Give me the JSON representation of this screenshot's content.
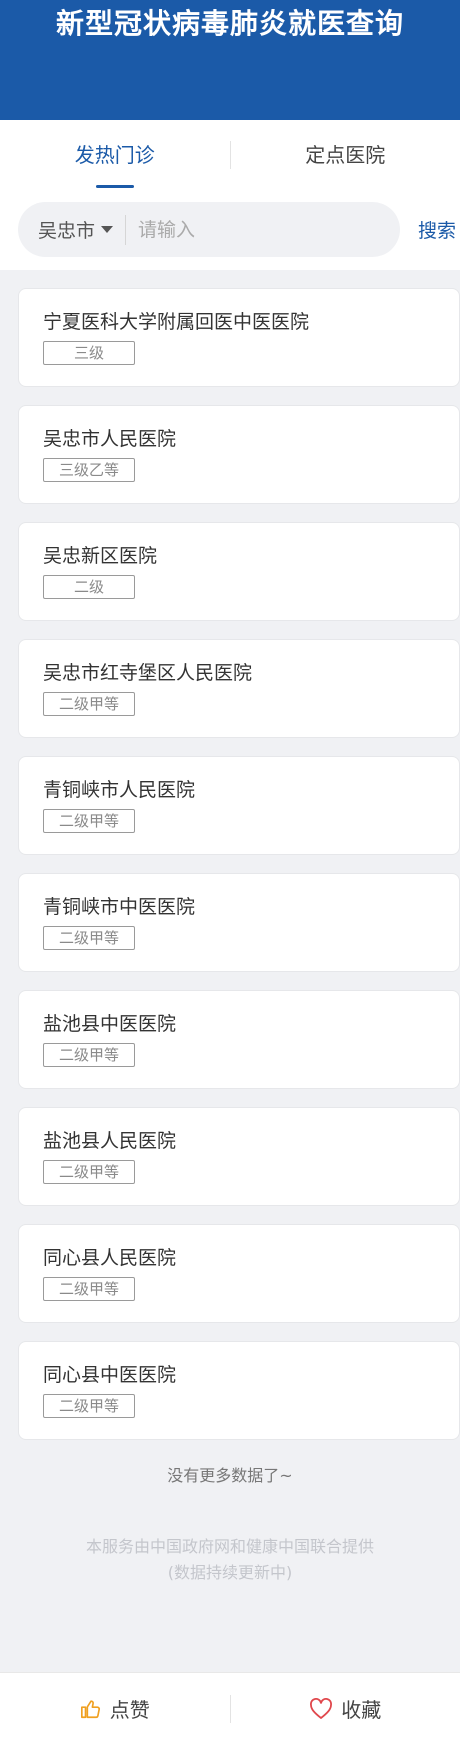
{
  "header": {
    "title": "新型冠状病毒肺炎就医查询"
  },
  "tabs": [
    {
      "label": "发热门诊",
      "active": true
    },
    {
      "label": "定点医院",
      "active": false
    }
  ],
  "search": {
    "city": "吴忠市",
    "placeholder": "请输入",
    "value": "",
    "button_label": "搜索"
  },
  "hospitals": [
    {
      "name": "宁夏医科大学附属回医中医医院",
      "level": "三级"
    },
    {
      "name": "吴忠市人民医院",
      "level": "三级乙等"
    },
    {
      "name": "吴忠新区医院",
      "level": "二级"
    },
    {
      "name": "吴忠市红寺堡区人民医院",
      "level": "二级甲等"
    },
    {
      "name": "青铜峡市人民医院",
      "level": "二级甲等"
    },
    {
      "name": "青铜峡市中医医院",
      "level": "二级甲等"
    },
    {
      "name": "盐池县中医医院",
      "level": "二级甲等"
    },
    {
      "name": "盐池县人民医院",
      "level": "二级甲等"
    },
    {
      "name": "同心县人民医院",
      "level": "二级甲等"
    },
    {
      "name": "同心县中医医院",
      "level": "二级甲等"
    }
  ],
  "list_end_text": "没有更多数据了~",
  "footer": {
    "line1": "本服务由中国政府网和健康中国联合提供",
    "line2": "(数据持续更新中)"
  },
  "bottom_bar": {
    "like_label": "点赞",
    "favorite_label": "收藏"
  },
  "colors": {
    "brand": "#1b5aa8",
    "like_icon": "#f0a020",
    "favorite_icon": "#e0474c"
  },
  "icons": {
    "caret": "caret-down-icon",
    "like": "thumbs-up-icon",
    "favorite": "heart-icon"
  }
}
